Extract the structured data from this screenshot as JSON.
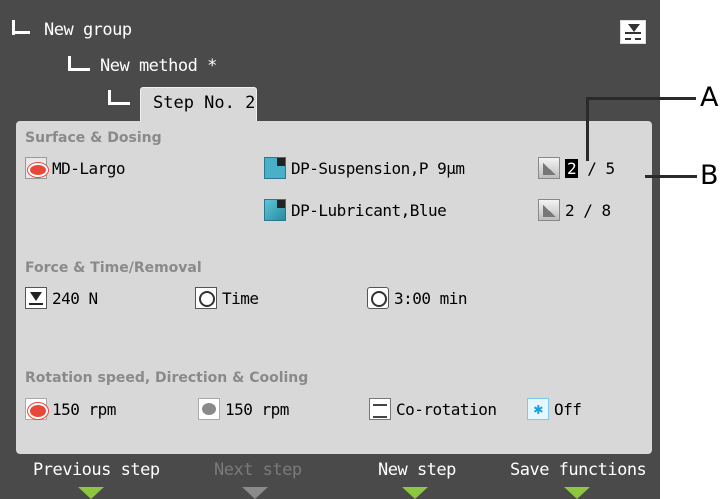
{
  "tree": {
    "group": "New group",
    "method": "New method *",
    "step_tab": "Step No. 2"
  },
  "sections": {
    "surface": {
      "title": "Surface & Dosing",
      "surface_name": "MD-Largo",
      "suspension": "DP-Suspension,P 9µm",
      "lubricant": "DP-Lubricant,Blue",
      "suspension_level_selected": "2",
      "suspension_level_rest": " / 5",
      "lubricant_level": "2 / 8"
    },
    "force": {
      "title": "Force & Time/Removal",
      "force": "240 N",
      "mode": "Time",
      "time": "3:00 min"
    },
    "rotation": {
      "title": "Rotation speed, Direction & Cooling",
      "disc_speed": "150 rpm",
      "holder_speed": "150 rpm",
      "direction": "Co-rotation",
      "cooling": "Off"
    }
  },
  "function_keys": [
    {
      "label": "Previous step",
      "enabled": true
    },
    {
      "label": "Next step",
      "enabled": false
    },
    {
      "label": "New step",
      "enabled": true
    },
    {
      "label": "Save functions",
      "enabled": true
    }
  ],
  "callouts": {
    "a": "A",
    "b": "B"
  },
  "colors": {
    "screen_bg": "#4a4a4a",
    "panel_bg": "#d8d8d8",
    "accent_green": "#8dc63f",
    "section_title": "#8a8a8a"
  },
  "icons": {
    "save": "save-download-icon",
    "surface": "polishing-disc-icon",
    "dosing": "bottle-icon",
    "level": "dosing-level-icon",
    "force": "force-down-icon",
    "mode": "time-mode-icon",
    "time": "clock-icon",
    "disc_speed": "disc-rotation-icon",
    "holder_speed": "holder-rotation-icon",
    "direction": "co-rotation-icon",
    "cooling": "snowflake-icon"
  }
}
